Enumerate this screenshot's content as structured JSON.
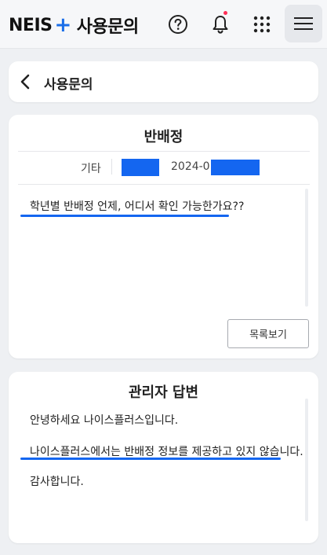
{
  "app": {
    "brand_name": "NEIS",
    "brand_plus": "+",
    "service_title": "사용문의",
    "icons": [
      "help-icon",
      "bell-icon",
      "apps-grid-icon",
      "hamburger-menu-icon"
    ],
    "accent_color": "#1466f0",
    "notification_dot_color": "#ff2d55"
  },
  "nav": {
    "back_title": "사용문의"
  },
  "question": {
    "title": "반배정",
    "category": "기타",
    "date_visible": "2024-01-",
    "body": "학년별 반배정 언제, 어디서 확인 가능한가요??",
    "list_button_label": "목록보기"
  },
  "answer": {
    "title": "관리자 답변",
    "lines": [
      "안녕하세요 나이스플러스입니다.",
      "나이스플러스에서는 반배정 정보를 제공하고 있지 않습니다.",
      "감사합니다."
    ]
  }
}
